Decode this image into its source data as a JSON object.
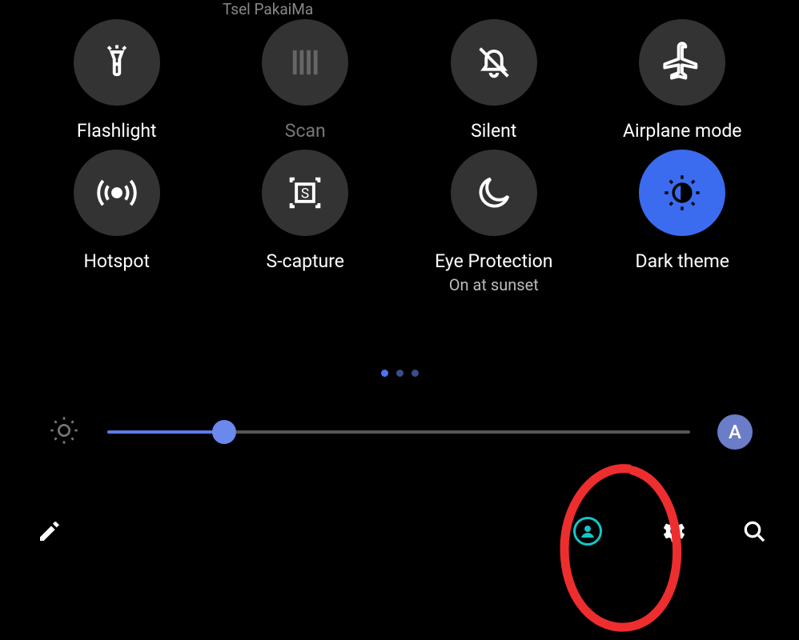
{
  "header": {
    "partial_text": "Tsel PakaiMa"
  },
  "tiles": [
    {
      "id": "flashlight",
      "label": "Flashlight",
      "sub": "",
      "active": false,
      "disabled": false
    },
    {
      "id": "scan",
      "label": "Scan",
      "sub": "",
      "active": false,
      "disabled": true
    },
    {
      "id": "silent",
      "label": "Silent",
      "sub": "",
      "active": false,
      "disabled": false
    },
    {
      "id": "airplane",
      "label": "Airplane mode",
      "sub": "",
      "active": false,
      "disabled": false
    },
    {
      "id": "hotspot",
      "label": "Hotspot",
      "sub": "",
      "active": false,
      "disabled": false
    },
    {
      "id": "scapture",
      "label": "S-capture",
      "sub": "",
      "active": false,
      "disabled": false
    },
    {
      "id": "eyeprotection",
      "label": "Eye Protection",
      "sub": "On at sunset",
      "active": false,
      "disabled": false
    },
    {
      "id": "darktheme",
      "label": "Dark theme",
      "sub": "",
      "active": true,
      "disabled": false
    }
  ],
  "pager": {
    "count": 3,
    "active": 0
  },
  "brightness": {
    "percent": 20,
    "auto_label": "A"
  },
  "bottom": {
    "edit": "edit",
    "user": "user",
    "settings": "settings",
    "search": "search"
  },
  "annotation": {
    "color": "#EE2E2E",
    "highlights": "settings"
  }
}
